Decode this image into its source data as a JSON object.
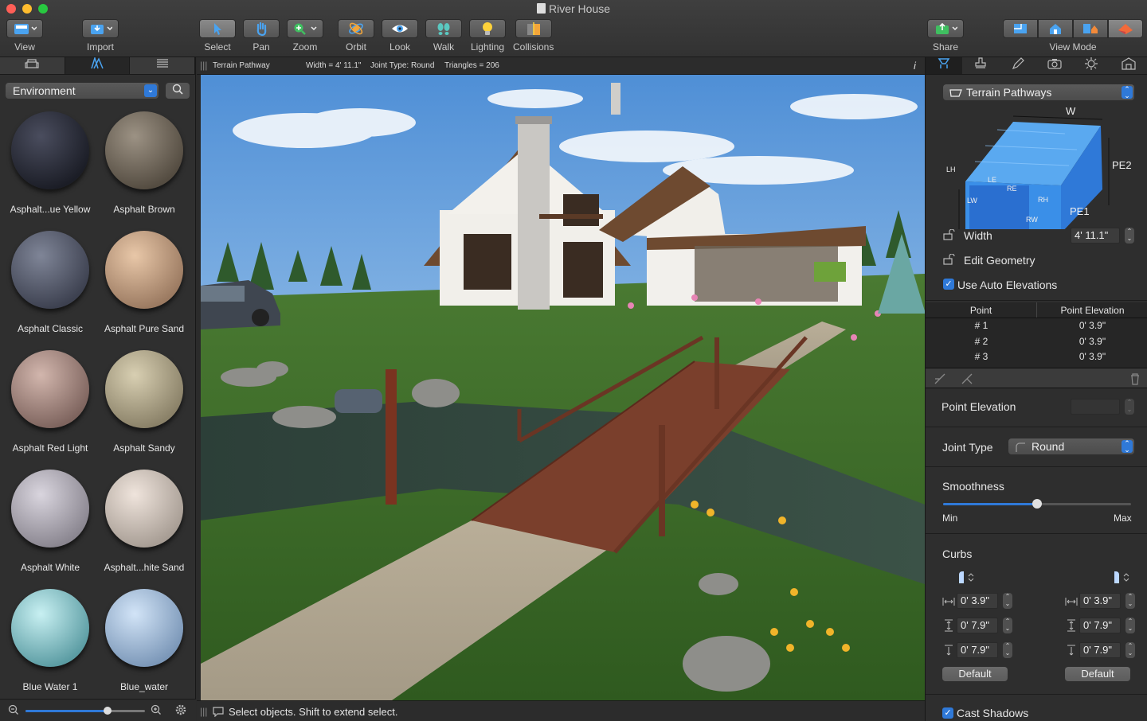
{
  "window": {
    "title": "River House"
  },
  "toolbar": {
    "view": "View",
    "import": "Import",
    "select": "Select",
    "pan": "Pan",
    "zoom": "Zoom",
    "orbit": "Orbit",
    "look": "Look",
    "walk": "Walk",
    "lighting": "Lighting",
    "collisions": "Collisions",
    "share": "Share",
    "view_mode": "View Mode"
  },
  "library": {
    "category": "Environment",
    "materials": [
      {
        "label": "Asphalt...ue Yellow",
        "color_a": "#4a4d5e",
        "color_b": "#1b1d26"
      },
      {
        "label": "Asphalt Brown",
        "color_a": "#9c9284",
        "color_b": "#544c41"
      },
      {
        "label": "Asphalt Classic",
        "color_a": "#7f8597",
        "color_b": "#3d4150"
      },
      {
        "label": "Asphalt Pure Sand",
        "color_a": "#e8c7a8",
        "color_b": "#9b7a61"
      },
      {
        "label": "Asphalt Red Light",
        "color_a": "#d2b6ad",
        "color_b": "#7e645e"
      },
      {
        "label": "Asphalt Sandy",
        "color_a": "#d8cfb2",
        "color_b": "#8a8168"
      },
      {
        "label": "Asphalt White",
        "color_a": "#d9d5de",
        "color_b": "#8a8690"
      },
      {
        "label": "Asphalt...hite Sand",
        "color_a": "#efe4dc",
        "color_b": "#a79d94"
      },
      {
        "label": "Blue Water 1",
        "color_a": "#c8f0f2",
        "color_b": "#5b9ca3"
      },
      {
        "label": "Blue_water",
        "color_a": "#d2e4f7",
        "color_b": "#7b97b8"
      }
    ]
  },
  "info_bar": {
    "object": "Terrain Pathway",
    "width": "Width = 4' 11.1\"",
    "joint": "Joint Type: Round",
    "triangles": "Triangles = 206",
    "info_glyph": "i"
  },
  "status": {
    "message": "Select objects. Shift to extend select."
  },
  "inspector": {
    "object_type": "Terrain Pathways",
    "diagram_labels": {
      "w": "W",
      "pe2": "PE2",
      "pe1": "PE1",
      "lh": "LH",
      "lw": "LW",
      "le": "LE",
      "re": "RE",
      "rh": "RH",
      "rw": "RW"
    },
    "width_label": "Width",
    "width_value": "4' 11.1\"",
    "edit_geometry": "Edit Geometry",
    "use_auto_elevations": "Use Auto Elevations",
    "table_headers": {
      "point": "Point",
      "elevation": "Point Elevation"
    },
    "points": [
      {
        "point": "# 1",
        "elevation": "0' 3.9\""
      },
      {
        "point": "# 2",
        "elevation": "0' 3.9\""
      },
      {
        "point": "# 3",
        "elevation": "0' 3.9\""
      }
    ],
    "point_elevation_label": "Point Elevation",
    "joint_type_label": "Joint Type",
    "joint_type_value": "Round",
    "smoothness_label": "Smoothness",
    "smoothness_min": "Min",
    "smoothness_max": "Max",
    "smoothness_value": 0.5,
    "curbs_label": "Curbs",
    "curbs_left": {
      "width": "0' 3.9\"",
      "height": "0' 7.9\"",
      "depth": "0' 7.9\""
    },
    "curbs_right": {
      "width": "0' 3.9\"",
      "height": "0' 7.9\"",
      "depth": "0' 7.9\""
    },
    "default_left": "Default",
    "default_right": "Default",
    "cast_shadows": "Cast Shadows"
  },
  "colors": {
    "accent": "#2f79d8",
    "panel": "#2e2e2e",
    "grass": "#3f6b2b",
    "sky": "#6aa2dc"
  }
}
